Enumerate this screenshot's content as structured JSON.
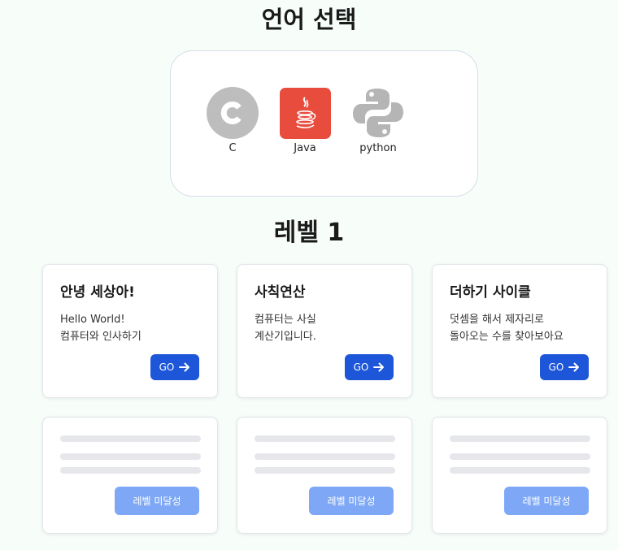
{
  "language_section": {
    "title": "언어 선택",
    "languages": [
      {
        "name": "C",
        "icon": "c-language-icon",
        "color": "#bdbdbd"
      },
      {
        "name": "Java",
        "icon": "java-coffee-icon",
        "color": "#e84c3d"
      },
      {
        "name": "python",
        "icon": "python-snakes-icon",
        "color": "#b5b5b5"
      }
    ]
  },
  "level_section": {
    "title": "레벨 1",
    "lessons": [
      {
        "title": "안녕 세상아!",
        "description": [
          "Hello World!",
          "컴퓨터와 인사하기"
        ],
        "button_label": "GO",
        "button_icon": "arrow-right-icon"
      },
      {
        "title": "사칙연산",
        "description": [
          "컴퓨터는 사실",
          "계산기입니다."
        ],
        "button_label": "GO",
        "button_icon": "arrow-right-icon"
      },
      {
        "title": "더하기 사이클",
        "description": [
          "덧셈을 해서 제자리로",
          "돌아오는 수를 찾아보아요"
        ],
        "button_label": "GO",
        "button_icon": "arrow-right-icon"
      }
    ],
    "locked": [
      {
        "button_label": "레벨 미달성"
      },
      {
        "button_label": "레벨 미달성"
      },
      {
        "button_label": "레벨 미달성"
      }
    ]
  },
  "colors": {
    "background": "#f7fdf9",
    "primary_button": "#1d56d8",
    "disabled_button": "#7ea8f6",
    "skeleton": "#e6e7eb"
  }
}
